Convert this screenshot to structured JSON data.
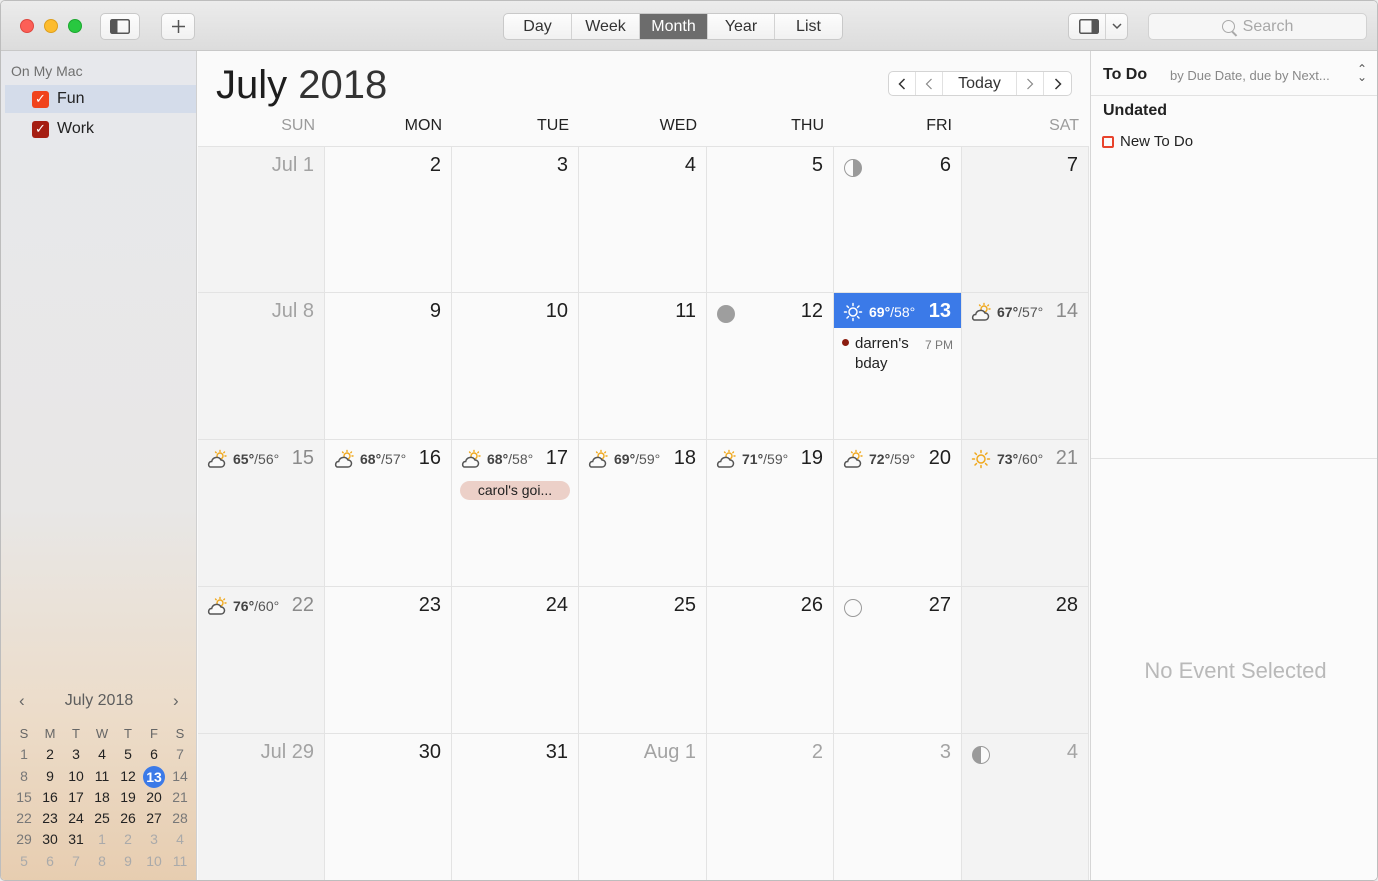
{
  "toolbar": {
    "view_tabs": [
      "Day",
      "Week",
      "Month",
      "Year",
      "List"
    ],
    "active_view": "Month",
    "search_placeholder": "Search"
  },
  "sidebar": {
    "section": "On My Mac",
    "calendars": [
      {
        "label": "Fun",
        "color": "#f0431c",
        "checked": true,
        "selected": true
      },
      {
        "label": "Work",
        "color": "#a51e12",
        "checked": true,
        "selected": false
      }
    ],
    "mini_calendar": {
      "title": "July 2018",
      "weekdays": [
        "S",
        "M",
        "T",
        "W",
        "T",
        "F",
        "S"
      ],
      "weeks": [
        [
          "1",
          "2",
          "3",
          "4",
          "5",
          "6",
          "7"
        ],
        [
          "8",
          "9",
          "10",
          "11",
          "12",
          "13",
          "14"
        ],
        [
          "15",
          "16",
          "17",
          "18",
          "19",
          "20",
          "21"
        ],
        [
          "22",
          "23",
          "24",
          "25",
          "26",
          "27",
          "28"
        ],
        [
          "29",
          "30",
          "31",
          "1",
          "2",
          "3",
          "4"
        ],
        [
          "5",
          "6",
          "7",
          "8",
          "9",
          "10",
          "11"
        ]
      ],
      "today": "13"
    }
  },
  "main": {
    "month": "July",
    "year": "2018",
    "today_label": "Today",
    "weekdays": [
      "SUN",
      "MON",
      "TUE",
      "WED",
      "THU",
      "FRI",
      "SAT"
    ],
    "weeks": [
      [
        {
          "label": "Jul 1",
          "dim": true
        },
        {
          "label": "2"
        },
        {
          "label": "3"
        },
        {
          "label": "4"
        },
        {
          "label": "5"
        },
        {
          "label": "6",
          "moon": "first-quarter"
        },
        {
          "label": "7"
        }
      ],
      [
        {
          "label": "Jul 8",
          "dim": true
        },
        {
          "label": "9"
        },
        {
          "label": "10"
        },
        {
          "label": "11"
        },
        {
          "label": "12",
          "moon": "new"
        },
        {
          "label": "13",
          "today": true,
          "weather": {
            "icon": "sun",
            "high": "69°",
            "low": "/58°"
          },
          "event": {
            "title": "darren's bday",
            "time": "7 PM"
          }
        },
        {
          "label": "14",
          "weather": {
            "icon": "partly-cloudy",
            "high": "67°",
            "low": "/57°"
          }
        }
      ],
      [
        {
          "label": "15",
          "weather": {
            "icon": "partly-cloudy",
            "high": "65°",
            "low": "/56°"
          }
        },
        {
          "label": "16",
          "weather": {
            "icon": "partly-cloudy",
            "high": "68°",
            "low": "/57°"
          }
        },
        {
          "label": "17",
          "weather": {
            "icon": "partly-cloudy",
            "high": "68°",
            "low": "/58°"
          },
          "pill": "carol's goi..."
        },
        {
          "label": "18",
          "weather": {
            "icon": "partly-cloudy",
            "high": "69°",
            "low": "/59°"
          }
        },
        {
          "label": "19",
          "weather": {
            "icon": "partly-cloudy",
            "high": "71°",
            "low": "/59°"
          }
        },
        {
          "label": "20",
          "weather": {
            "icon": "partly-cloudy",
            "high": "72°",
            "low": "/59°"
          }
        },
        {
          "label": "21",
          "weather": {
            "icon": "sun",
            "high": "73°",
            "low": "/60°"
          }
        }
      ],
      [
        {
          "label": "22",
          "weather": {
            "icon": "partly-cloudy",
            "high": "76°",
            "low": "/60°"
          }
        },
        {
          "label": "23"
        },
        {
          "label": "24"
        },
        {
          "label": "25"
        },
        {
          "label": "26"
        },
        {
          "label": "27",
          "moon": "full"
        },
        {
          "label": "28"
        }
      ],
      [
        {
          "label": "Jul 29",
          "dim": true
        },
        {
          "label": "30"
        },
        {
          "label": "31"
        },
        {
          "label": "Aug 1",
          "dim": true
        },
        {
          "label": "2",
          "dim": true
        },
        {
          "label": "3",
          "dim": true
        },
        {
          "label": "4",
          "dim": true,
          "moon": "last-quarter"
        }
      ]
    ]
  },
  "panel": {
    "title": "To Do",
    "sort": "by Due Date, due by Next...",
    "group": "Undated",
    "items": [
      "New To Do"
    ],
    "empty_text": "No Event Selected"
  },
  "colors": {
    "accent": "#3b7ae8",
    "event_dot": "#8b1c0f",
    "pill": "#ecd0c8",
    "todo_box": "#e8432c"
  }
}
